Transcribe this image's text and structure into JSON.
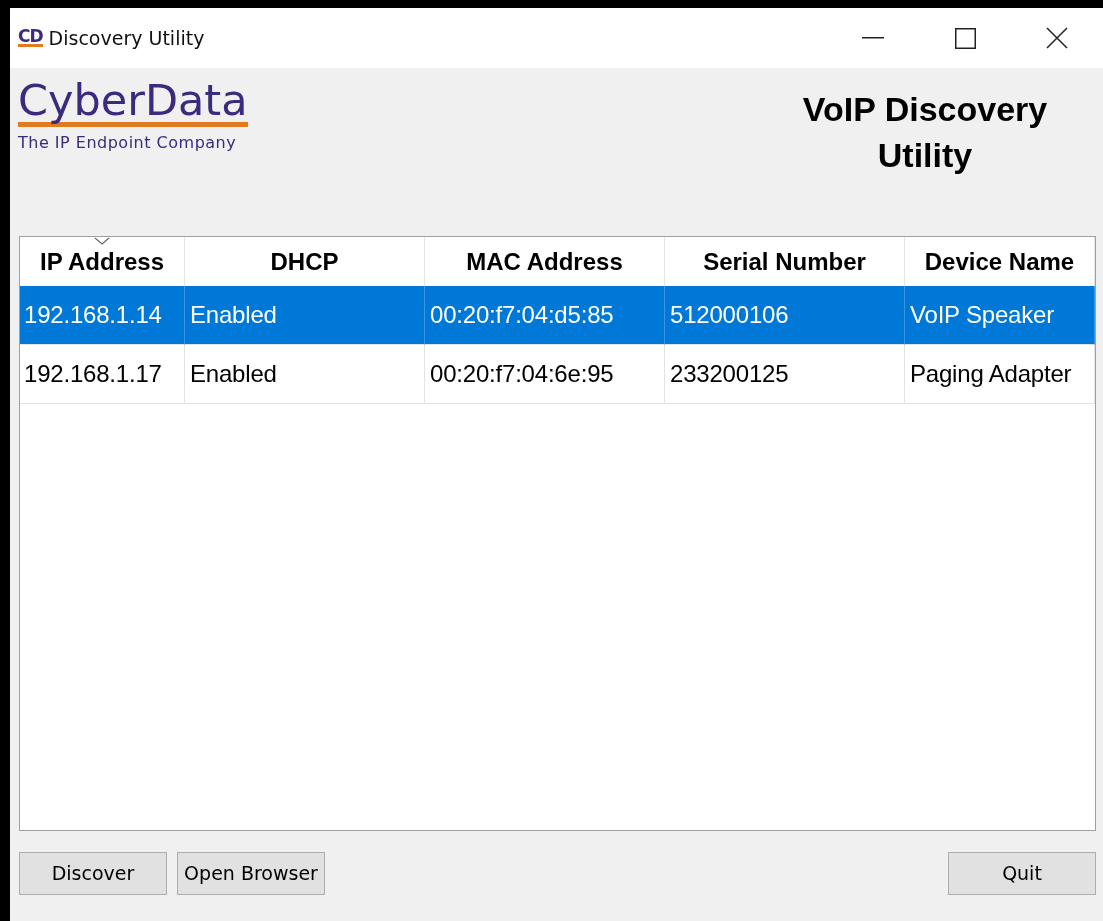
{
  "window": {
    "logo": "CD",
    "title": "Discovery Utility"
  },
  "brand": {
    "name": "CyberData",
    "tagline": "The IP Endpoint Company"
  },
  "heading": "VoIP Discovery Utility",
  "table": {
    "columns": [
      {
        "label": "IP Address",
        "sorted": true
      },
      {
        "label": "DHCP",
        "sorted": false
      },
      {
        "label": "MAC Address",
        "sorted": false
      },
      {
        "label": "Serial Number",
        "sorted": false
      },
      {
        "label": "Device Name",
        "sorted": false
      }
    ],
    "rows": [
      {
        "selected": true,
        "cells": [
          "192.168.1.14",
          "Enabled",
          "00:20:f7:04:d5:85",
          "512000106",
          "VoIP Speaker"
        ]
      },
      {
        "selected": false,
        "cells": [
          "192.168.1.17",
          "Enabled",
          "00:20:f7:04:6e:95",
          "233200125",
          "Paging Adapter"
        ]
      }
    ]
  },
  "buttons": {
    "left": [
      "Discover",
      "Open Browser"
    ],
    "right": [
      "Quit"
    ]
  }
}
